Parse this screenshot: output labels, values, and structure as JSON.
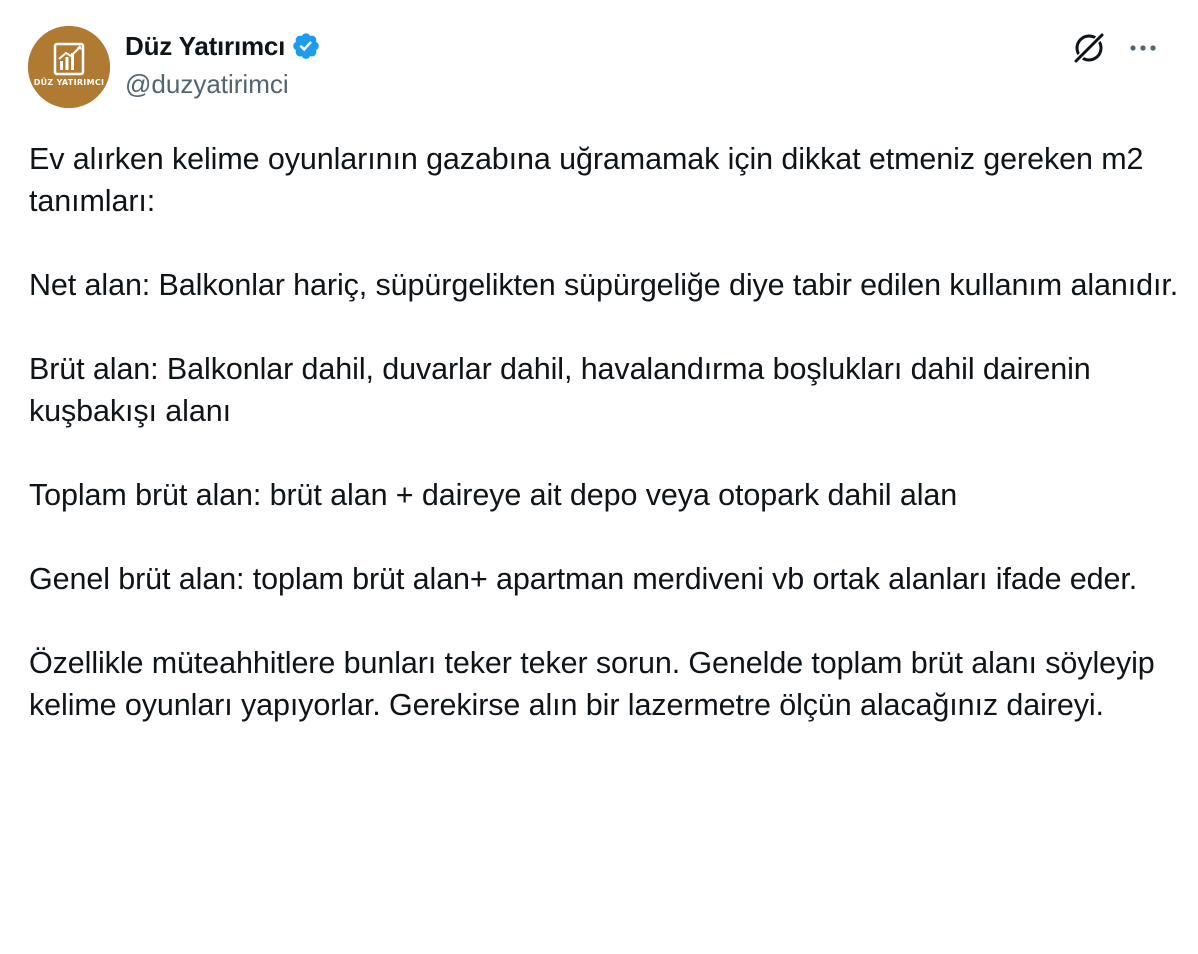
{
  "author": {
    "display_name": "Düz Yatırımcı",
    "handle": "@duzyatirimci",
    "avatar_text": "DÜZ YATIRIMCI",
    "avatar_color": "#b07a33",
    "verified_color": "#1d9bf0"
  },
  "icons": {
    "grok": "grok-icon",
    "more": "more-options-icon",
    "verified": "verified-badge-icon"
  },
  "tweet": {
    "paragraphs": [
      "Ev alırken kelime oyunlarının gazabına uğramamak için dikkat etmeniz gereken m2 tanımları:",
      "Net alan: Balkonlar hariç, süpürgelikten süpürgeliğe diye tabir edilen kullanım alanıdır.",
      "Brüt alan: Balkonlar dahil, duvarlar dahil, havalandırma boşlukları dahil dairenin kuşbakışı alanı",
      "Toplam brüt alan: brüt alan + daireye ait depo veya otopark dahil alan",
      "Genel brüt alan: toplam brüt alan+ apartman merdiveni vb ortak alanları ifade eder.",
      "Özellikle müteahhitlere bunları teker teker sorun. Genelde toplam brüt alanı söyleyip kelime oyunları yapıyorlar. Gerekirse alın bir lazermetre ölçün alacağınız daireyi."
    ]
  }
}
